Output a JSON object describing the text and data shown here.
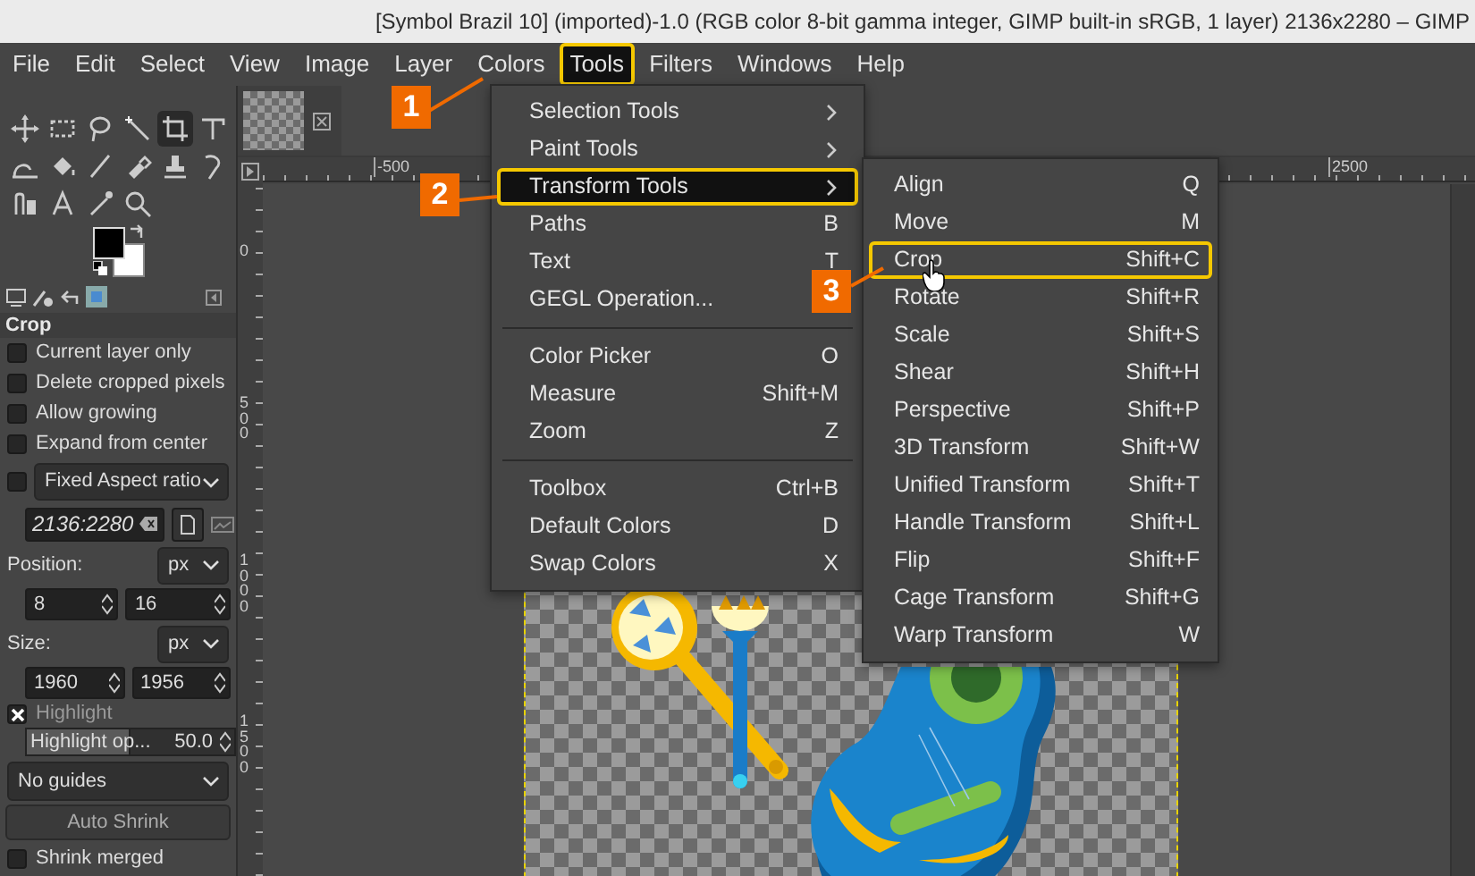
{
  "window": {
    "title": "[Symbol Brazil 10] (imported)-1.0 (RGB color 8-bit gamma integer, GIMP built-in sRGB, 1 layer) 2136x2280 – GIMP"
  },
  "menubar": [
    {
      "label": "File",
      "selected": false
    },
    {
      "label": "Edit",
      "selected": false
    },
    {
      "label": "Select",
      "selected": false
    },
    {
      "label": "View",
      "selected": false
    },
    {
      "label": "Image",
      "selected": false
    },
    {
      "label": "Layer",
      "selected": false
    },
    {
      "label": "Colors",
      "selected": false
    },
    {
      "label": "Tools",
      "selected": true
    },
    {
      "label": "Filters",
      "selected": false
    },
    {
      "label": "Windows",
      "selected": false
    },
    {
      "label": "Help",
      "selected": false
    }
  ],
  "tool_options": {
    "title": "Crop",
    "checkboxes": [
      {
        "label": "Current layer only",
        "checked": false
      },
      {
        "label": "Delete cropped pixels",
        "checked": false
      },
      {
        "label": "Allow growing",
        "checked": false
      },
      {
        "label": "Expand from center",
        "checked": false
      }
    ],
    "fixed": {
      "checked": false,
      "mode": "Fixed Aspect ratio",
      "value": "2136:2280"
    },
    "position": {
      "label": "Position:",
      "unit": "px",
      "values": [
        "8",
        "16"
      ]
    },
    "size": {
      "label": "Size:",
      "unit": "px",
      "values": [
        "1960",
        "1956"
      ]
    },
    "highlight": {
      "label": "Highlight",
      "checked": true
    },
    "highlight_opacity": {
      "label": "Highlight op...",
      "reading": "50.0",
      "level": 0.5
    },
    "guides": "No guides",
    "auto_shrink": "Auto Shrink",
    "shrink_merged": {
      "label": "Shrink merged",
      "checked": false
    }
  },
  "rulers": {
    "horizontal": [
      "-500",
      "2500"
    ],
    "vertical": [
      "0",
      "500",
      "1000",
      "1500"
    ]
  },
  "tools_menu": {
    "groups": [
      [
        {
          "label": "Selection Tools",
          "submenu": true,
          "selected": false
        },
        {
          "label": "Paint Tools",
          "submenu": true,
          "selected": false
        },
        {
          "label": "Transform Tools",
          "submenu": true,
          "selected": true
        },
        {
          "label": "Paths",
          "shortcut": "B",
          "submenu": false,
          "selected": false
        },
        {
          "label": "Text",
          "shortcut": "T",
          "submenu": false,
          "selected": false
        },
        {
          "label": "GEGL Operation...",
          "submenu": false,
          "selected": false
        }
      ],
      [
        {
          "label": "Color Picker",
          "shortcut": "O",
          "submenu": false,
          "selected": false
        },
        {
          "label": "Measure",
          "shortcut": "Shift+M",
          "submenu": false,
          "selected": false
        },
        {
          "label": "Zoom",
          "shortcut": "Z",
          "submenu": false,
          "selected": false
        }
      ],
      [
        {
          "label": "Toolbox",
          "shortcut": "Ctrl+B",
          "submenu": false,
          "selected": false
        },
        {
          "label": "Default Colors",
          "shortcut": "D",
          "submenu": false,
          "selected": false
        },
        {
          "label": "Swap Colors",
          "shortcut": "X",
          "submenu": false,
          "selected": false
        }
      ]
    ]
  },
  "transform_menu": {
    "items": [
      {
        "label": "Align",
        "shortcut": "Q",
        "selected": false
      },
      {
        "label": "Move",
        "shortcut": "M",
        "selected": false
      },
      {
        "label": "Crop",
        "shortcut": "Shift+C",
        "selected": true
      },
      {
        "label": "Rotate",
        "shortcut": "Shift+R",
        "selected": false
      },
      {
        "label": "Scale",
        "shortcut": "Shift+S",
        "selected": false
      },
      {
        "label": "Shear",
        "shortcut": "Shift+H",
        "selected": false
      },
      {
        "label": "Perspective",
        "shortcut": "Shift+P",
        "selected": false
      },
      {
        "label": "3D Transform",
        "shortcut": "Shift+W",
        "selected": false
      },
      {
        "label": "Unified Transform",
        "shortcut": "Shift+T",
        "selected": false
      },
      {
        "label": "Handle Transform",
        "shortcut": "Shift+L",
        "selected": false
      },
      {
        "label": "Flip",
        "shortcut": "Shift+F",
        "selected": false
      },
      {
        "label": "Cage Transform",
        "shortcut": "Shift+G",
        "selected": false
      },
      {
        "label": "Warp Transform",
        "shortcut": "W",
        "selected": false
      }
    ]
  },
  "callouts": [
    "1",
    "2",
    "3"
  ]
}
